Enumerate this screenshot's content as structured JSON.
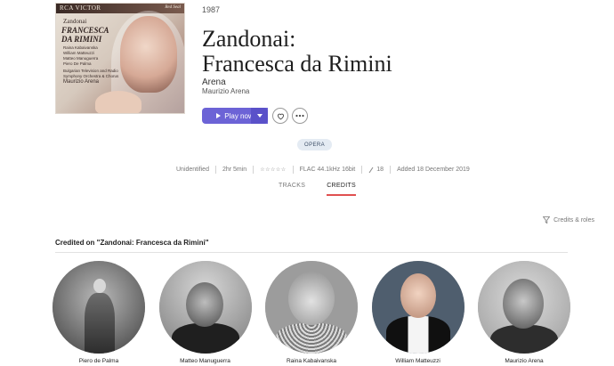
{
  "album": {
    "year": "1987",
    "title_line1": "Zandonai:",
    "title_line2": "Francesca da Rimini",
    "artist": "Arena",
    "conductor": "Maurizio Arena",
    "cover": {
      "label": "RCA VICTOR",
      "label_right": "Red Seal",
      "composer": "Zandonai",
      "title_l1": "FRANCESCA",
      "title_l2": "DA RIMINI",
      "cast": [
        "Raina Kabaivanska",
        "William Matteuzzi",
        "Matteo Manuguerra",
        "Piero De Palma",
        "Bulgarian Television and Radio",
        "Symphony Orchestra & Chorus",
        "Maurizio Arena"
      ]
    }
  },
  "actions": {
    "play_label": "Play now",
    "favorite_icon": "heart-icon",
    "more_icon": "ellipsis-icon"
  },
  "genre": "OPERA",
  "meta": {
    "status": "Unidentified",
    "duration": "2hr 5min",
    "rating": "☆☆☆☆☆",
    "format": "FLAC 44.1kHz 16bit",
    "tracks": "18",
    "added": "Added 18 December 2019"
  },
  "tabs": [
    {
      "label": "TRACKS",
      "active": false
    },
    {
      "label": "CREDITS",
      "active": true
    }
  ],
  "credits_filter_label": "Credits & roles",
  "credited_on_label": "Credited on \"Zandonai: Francesca da Rimini\"",
  "people": [
    {
      "name": "Piero de Palma"
    },
    {
      "name": "Matteo Manuguerra"
    },
    {
      "name": "Raina Kabaivanska"
    },
    {
      "name": "William Matteuzzi"
    },
    {
      "name": "Maurizio Arena"
    }
  ],
  "colors": {
    "accent": "#6c63d6",
    "tab_underline": "#e05050",
    "genre_bg": "#e4ebf3"
  }
}
